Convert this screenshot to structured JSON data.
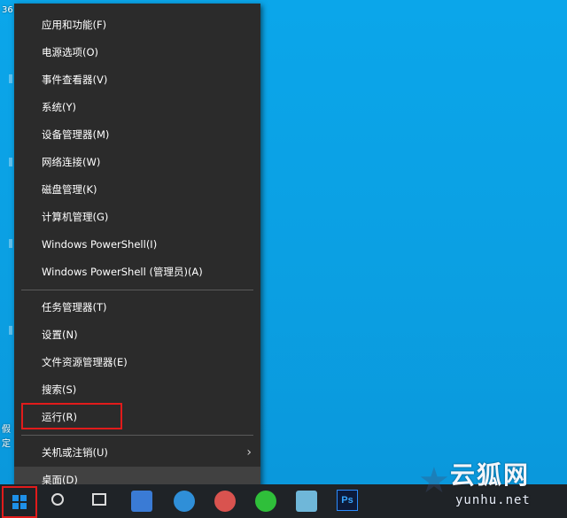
{
  "desktop": {
    "left_labels": [
      "36",
      "假",
      "定"
    ]
  },
  "menu": {
    "group1": [
      {
        "label": "应用和功能(F)"
      },
      {
        "label": "电源选项(O)"
      },
      {
        "label": "事件查看器(V)"
      },
      {
        "label": "系统(Y)"
      },
      {
        "label": "设备管理器(M)"
      },
      {
        "label": "网络连接(W)"
      },
      {
        "label": "磁盘管理(K)"
      },
      {
        "label": "计算机管理(G)"
      },
      {
        "label": "Windows PowerShell(I)"
      },
      {
        "label": "Windows PowerShell (管理员)(A)"
      }
    ],
    "group2": [
      {
        "label": "任务管理器(T)"
      },
      {
        "label": "设置(N)"
      },
      {
        "label": "文件资源管理器(E)"
      },
      {
        "label": "搜索(S)"
      },
      {
        "label": "运行(R)"
      }
    ],
    "group3": [
      {
        "label": "关机或注销(U)"
      },
      {
        "label": "桌面(D)"
      }
    ],
    "submenu_arrow": "›"
  },
  "taskbar": {
    "ps_label": "Ps"
  },
  "watermark": {
    "title": "云狐网",
    "sub": "yunhu.net"
  },
  "colors": {
    "menu_bg": "#2b2b2b",
    "menu_hover": "#414141",
    "highlight": "#e11b1b",
    "desktop": "#0ba6ea",
    "taskbar": "#1f2327"
  }
}
